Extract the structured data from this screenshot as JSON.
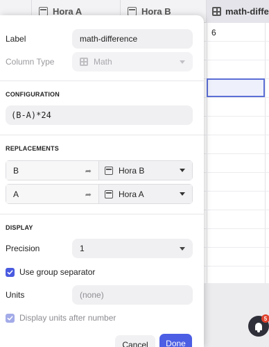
{
  "grid": {
    "columns": [
      {
        "label": "Hora A",
        "icon": "table-icon"
      },
      {
        "label": "Hora B",
        "icon": "table-icon"
      },
      {
        "label": "math-diffe",
        "icon": "calculator-icon"
      }
    ],
    "first_value": "6"
  },
  "panel": {
    "label_caption": "Label",
    "label_value": "math-difference",
    "column_type_caption": "Column Type",
    "column_type_value": "Math",
    "configuration_heading": "CONFIGURATION",
    "formula": "(B-A)*24",
    "replacements_heading": "REPLACEMENTS",
    "replacements": [
      {
        "variable": "B",
        "column": "Hora B"
      },
      {
        "variable": "A",
        "column": "Hora A"
      }
    ],
    "display_heading": "DISPLAY",
    "precision_caption": "Precision",
    "precision_value": "1",
    "group_separator_label": "Use group separator",
    "group_separator_checked": true,
    "units_caption": "Units",
    "units_placeholder": "(none)",
    "units_after_label": "Display units after number",
    "units_after_checked": true,
    "cancel_label": "Cancel",
    "done_label": "Done"
  },
  "notifications": {
    "count": "5"
  },
  "colors": {
    "accent": "#4b5ee4",
    "badge": "#e0432f"
  }
}
